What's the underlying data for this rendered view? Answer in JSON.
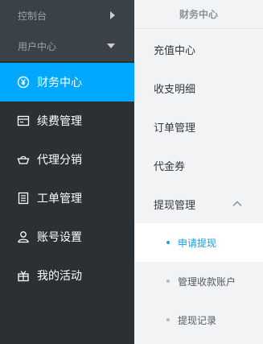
{
  "sidebar": {
    "groups": [
      {
        "label": "控制台"
      },
      {
        "label": "用户中心"
      }
    ],
    "items": [
      {
        "label": "财务中心",
        "icon": "yen-circle-icon"
      },
      {
        "label": "续费管理",
        "icon": "calendar-icon"
      },
      {
        "label": "代理分销",
        "icon": "basket-icon"
      },
      {
        "label": "工单管理",
        "icon": "document-list-icon"
      },
      {
        "label": "账号设置",
        "icon": "user-icon"
      },
      {
        "label": "我的活动",
        "icon": "gift-icon"
      }
    ],
    "active_color": "#00a8ff"
  },
  "panel": {
    "title": "财务中心",
    "items": [
      {
        "label": "充值中心"
      },
      {
        "label": "收支明细"
      },
      {
        "label": "订单管理"
      },
      {
        "label": "代金券"
      },
      {
        "label": "提现管理"
      }
    ],
    "subitems": [
      {
        "label": "申请提现"
      },
      {
        "label": "管理收款账户"
      },
      {
        "label": "提现记录"
      }
    ],
    "active_color": "#1a9be6"
  }
}
